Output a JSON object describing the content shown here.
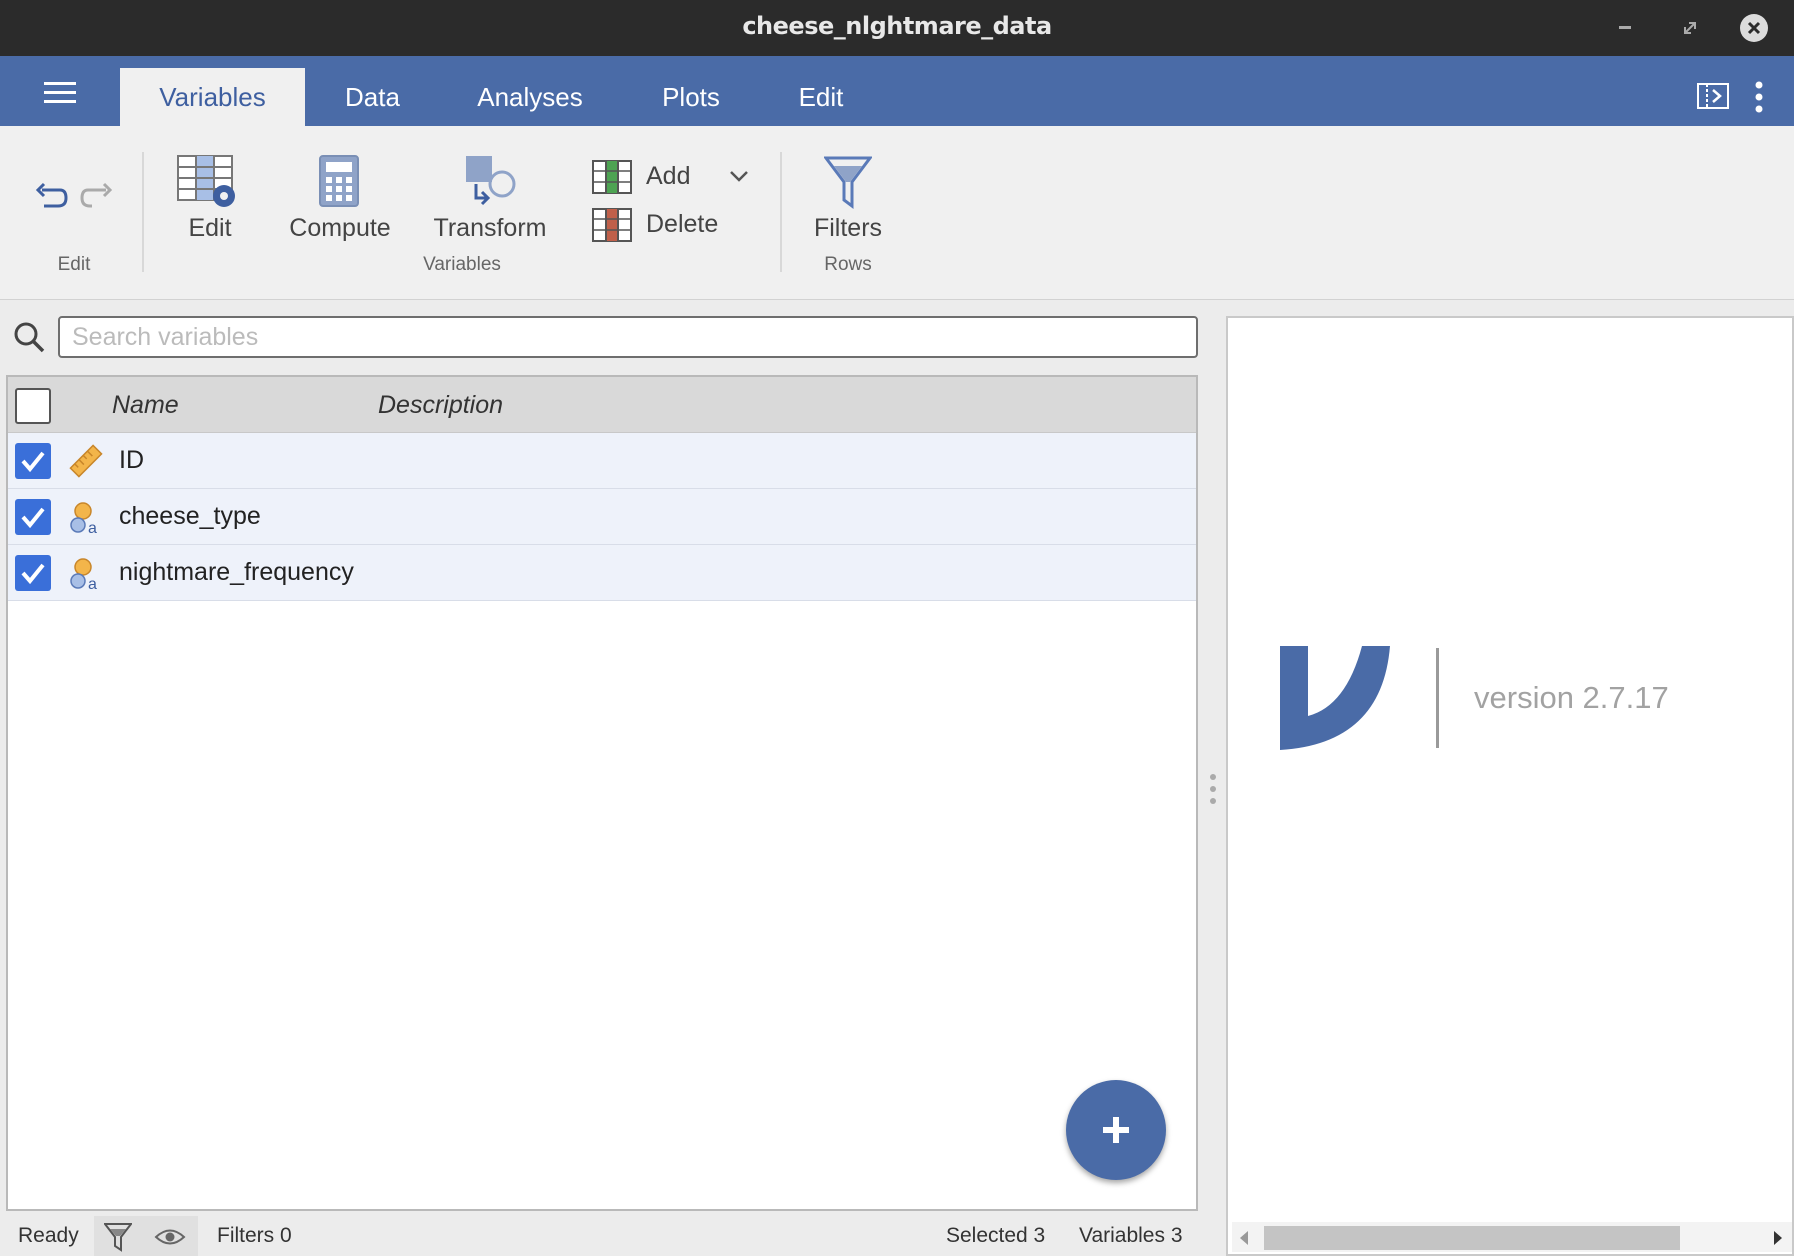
{
  "window": {
    "title": "cheese_nlghtmare_data"
  },
  "tabs": [
    {
      "label": "Variables",
      "active": true
    },
    {
      "label": "Data",
      "active": false
    },
    {
      "label": "Analyses",
      "active": false
    },
    {
      "label": "Plots",
      "active": false
    },
    {
      "label": "Edit",
      "active": false
    }
  ],
  "ribbon": {
    "edit_group_label": "Edit",
    "variables_group_label": "Variables",
    "rows_group_label": "Rows",
    "edit_label": "Edit",
    "compute_label": "Compute",
    "transform_label": "Transform",
    "add_label": "Add",
    "delete_label": "Delete",
    "filters_label": "Filters"
  },
  "search": {
    "placeholder": "Search variables",
    "value": ""
  },
  "table": {
    "headers": {
      "name": "Name",
      "description": "Description"
    },
    "rows": [
      {
        "name": "ID",
        "description": "",
        "checked": true,
        "icon": "ruler-icon"
      },
      {
        "name": "cheese_type",
        "description": "",
        "checked": true,
        "icon": "nominal-text-icon"
      },
      {
        "name": "nightmare_frequency",
        "description": "",
        "checked": true,
        "icon": "nominal-text-icon"
      }
    ]
  },
  "welcome": {
    "version": "version 2.7.17"
  },
  "status": {
    "ready": "Ready",
    "filters": "Filters 0",
    "selected": "Selected 3",
    "variables": "Variables 3"
  },
  "colors": {
    "brand": "#4a6ba7",
    "titlebar": "#2b2b2b",
    "checkbox": "#3a6fd9"
  }
}
